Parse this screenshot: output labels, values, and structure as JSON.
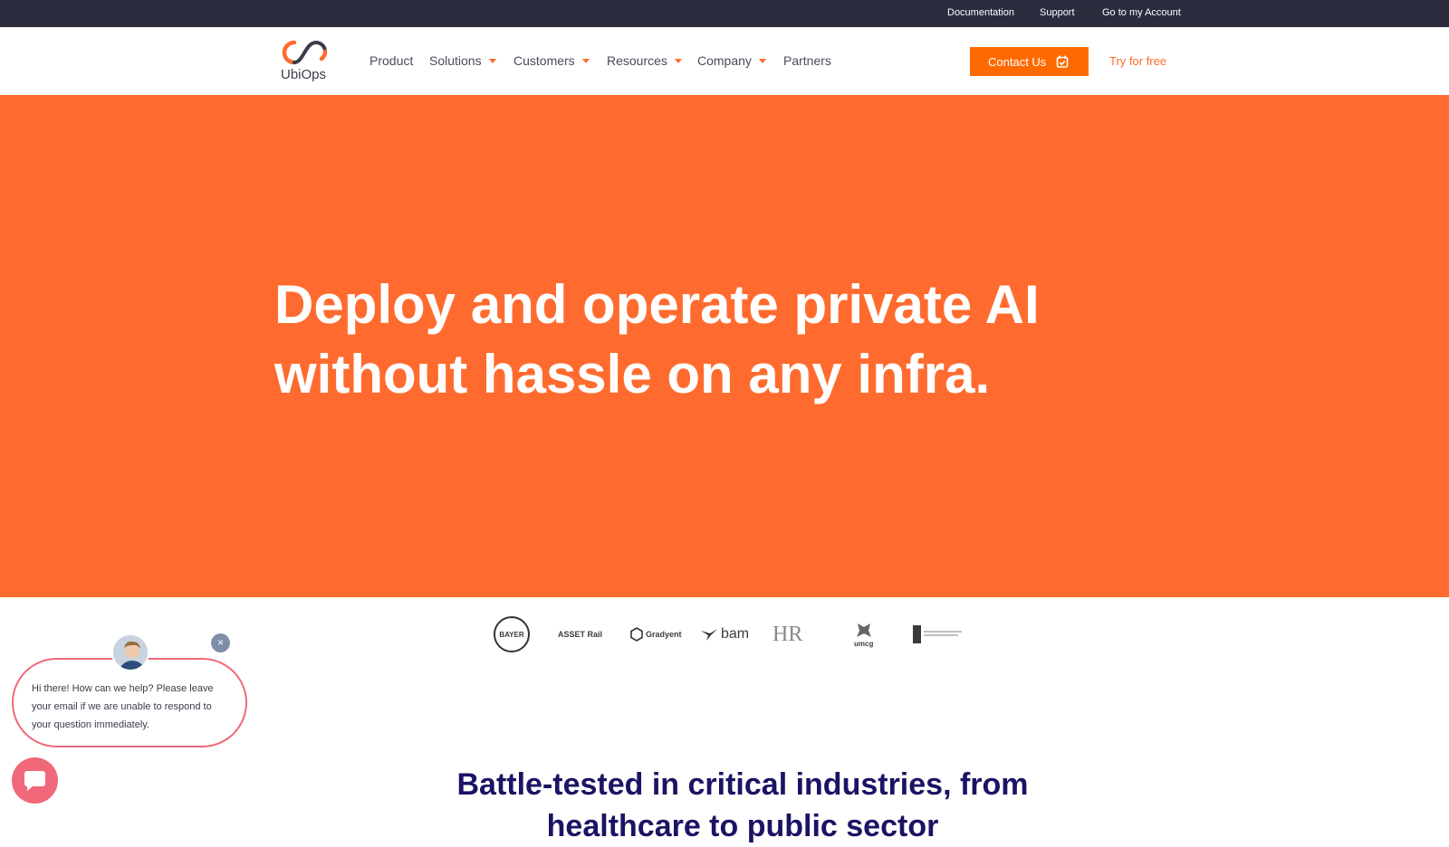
{
  "topbar": {
    "links": [
      "Documentation",
      "Support",
      "Go to my Account"
    ]
  },
  "brand": {
    "name": "UbiOps",
    "color": "#ff6b2c"
  },
  "nav": {
    "items": [
      {
        "label": "Product",
        "dropdown": false
      },
      {
        "label": "Solutions",
        "dropdown": true
      },
      {
        "label": "Customers",
        "dropdown": true
      },
      {
        "label": "Resources",
        "dropdown": true
      },
      {
        "label": "Company",
        "dropdown": true
      },
      {
        "label": "Partners",
        "dropdown": false
      }
    ],
    "contact_label": "Contact Us",
    "try_label": "Try for free"
  },
  "hero": {
    "title_line1": "Deploy and operate private AI",
    "title_line2": "without hassle on any infra.",
    "background": "#ff6b2f"
  },
  "clients": {
    "bayer": "BAYER",
    "asset_rail": "ASSET Rail",
    "gradyent": "Gradyent",
    "bam": "bam",
    "hr": "HR",
    "umcg": "umcg"
  },
  "section": {
    "title_line1": "Battle-tested in critical industries, from",
    "title_line2": "healthcare to public sector"
  },
  "chat": {
    "message": "Hi there! How can we help? Please leave your email if we are unable to respond to your question immediately.",
    "close_symbol": "×",
    "accent": "#f0687a"
  }
}
